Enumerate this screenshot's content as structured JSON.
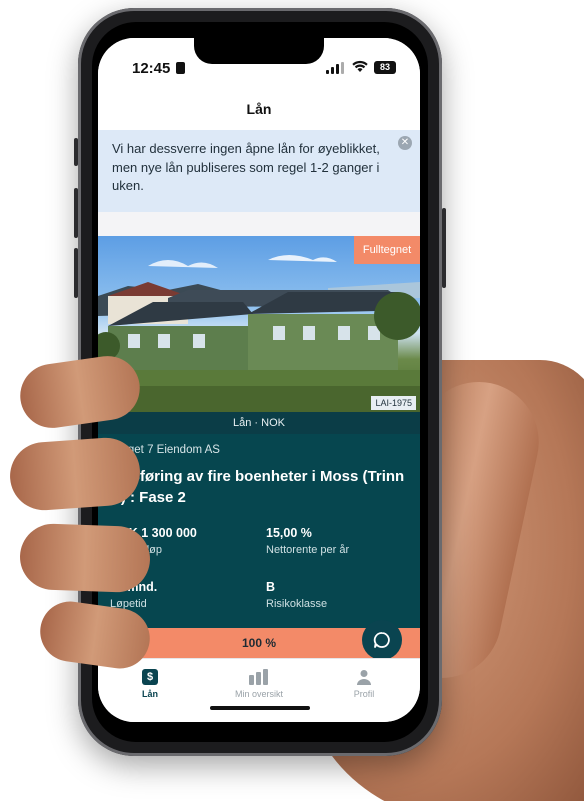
{
  "status_bar": {
    "time": "12:45",
    "battery": "83"
  },
  "nav": {
    "title": "Lån"
  },
  "banner": {
    "text": "Vi har dessverre ingen åpne lån for øyeblikket, men nye lån publiseres som regel 1-2 ganger i uken.",
    "close_icon": "close-icon"
  },
  "loan_card": {
    "badge": "Fulltegnet",
    "loan_id": "LAI-1975",
    "caption": "Lån · NOK",
    "issuer": "Berget 7 Eiendom AS",
    "title": "Oppføring av fire boenheter i Moss (Trinn B) : Fase 2",
    "stats": [
      {
        "value": "NOK 1 300 000",
        "label": "Lånebeløp"
      },
      {
        "value": "15,00 %",
        "label": "Nettorente per år"
      },
      {
        "value": "16 mnd.",
        "label": "Løpetid"
      },
      {
        "value": "B",
        "label": "Risikoklasse"
      }
    ],
    "progress_text": "100 %",
    "progress": 1.0
  },
  "tabs": [
    {
      "label": "Lån",
      "icon": "dollar-icon",
      "active": true
    },
    {
      "label": "Min oversikt",
      "icon": "bar-chart-icon",
      "active": false
    },
    {
      "label": "Profil",
      "icon": "person-icon",
      "active": false
    }
  ],
  "colors": {
    "accent": "#f38a68",
    "card": "#06464f",
    "banner": "#dde9f7"
  }
}
